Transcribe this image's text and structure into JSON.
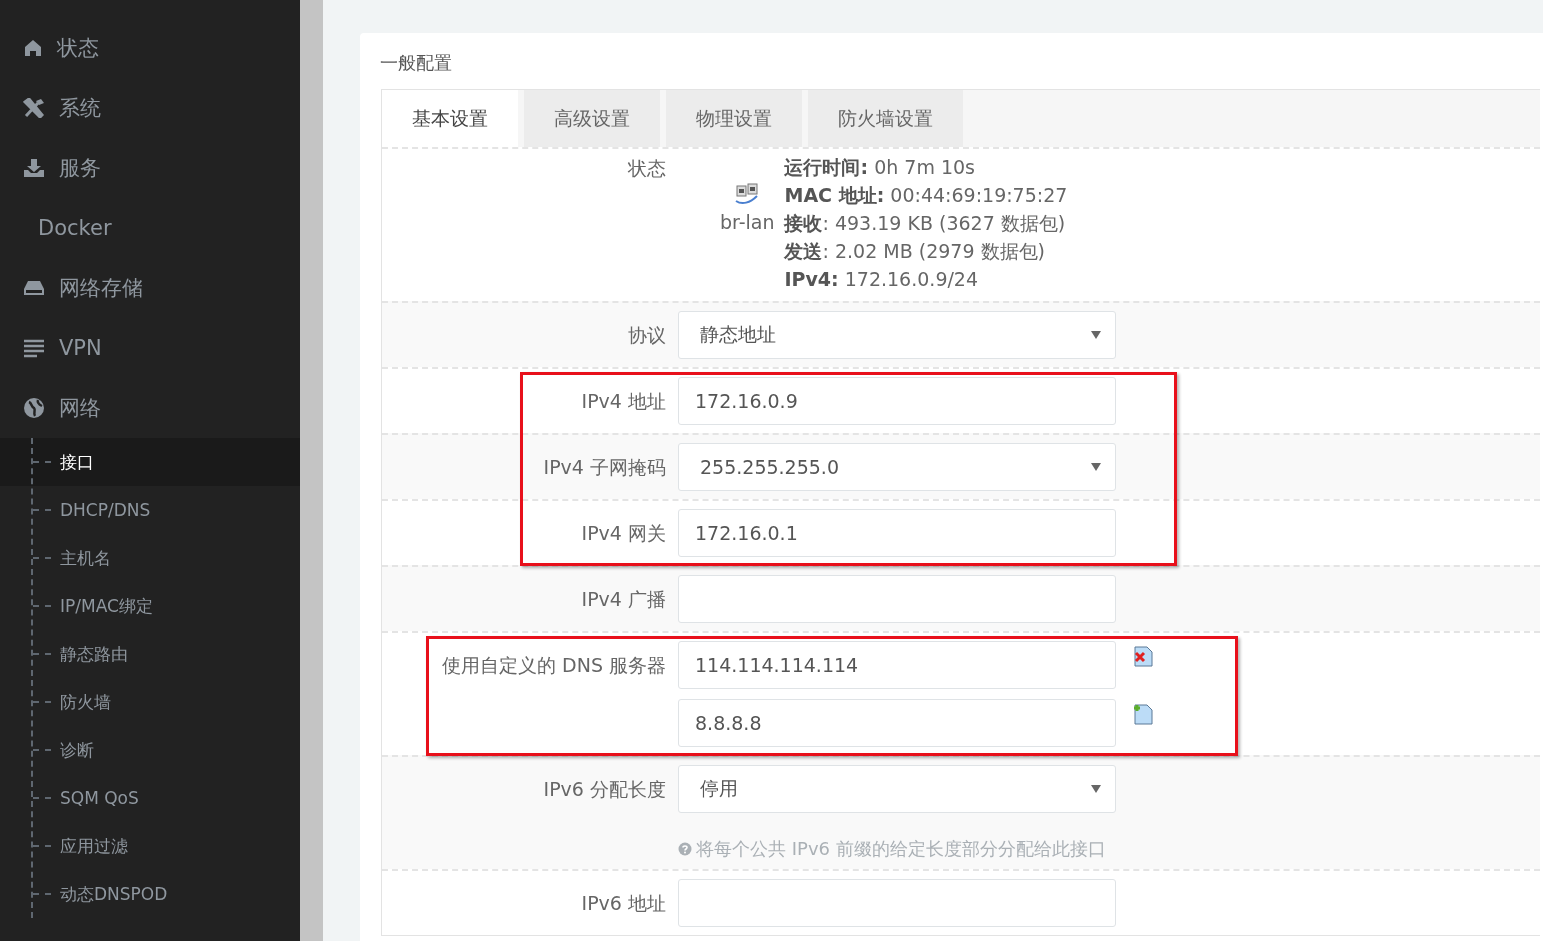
{
  "sidebar": {
    "items": [
      {
        "label": "状态",
        "selected": false
      },
      {
        "label": "系统",
        "selected": false
      },
      {
        "label": "服务",
        "selected": false
      },
      {
        "label": "Docker",
        "selected": false
      },
      {
        "label": "网络存储",
        "selected": false
      },
      {
        "label": "VPN",
        "selected": false
      },
      {
        "label": "网络",
        "selected": false,
        "expanded": true,
        "children": [
          {
            "label": "接口",
            "selected": true
          },
          {
            "label": "DHCP/DNS",
            "selected": false
          },
          {
            "label": "主机名",
            "selected": false
          },
          {
            "label": "IP/MAC绑定",
            "selected": false
          },
          {
            "label": "静态路由",
            "selected": false
          },
          {
            "label": "防火墙",
            "selected": false
          },
          {
            "label": "诊断",
            "selected": false
          },
          {
            "label": "SQM QoS",
            "selected": false
          },
          {
            "label": "应用过滤",
            "selected": false
          },
          {
            "label": "动态DNSPOD",
            "selected": false
          }
        ]
      }
    ]
  },
  "section_title": "一般配置",
  "tabs": [
    {
      "label": "基本设置",
      "selected": true
    },
    {
      "label": "高级设置",
      "selected": false
    },
    {
      "label": "物理设置",
      "selected": false
    },
    {
      "label": "防火墙设置",
      "selected": false
    }
  ],
  "rows": [
    {
      "kind": "status",
      "label": "状态",
      "device": "br-lan",
      "highlighted": false,
      "lines": [
        "**运行时间:** 0h 7m 10s",
        "**MAC 地址:** 00:44:69:19:75:27",
        "**接收**: 493.19 KB (3627 数据包)",
        "**发送**: 2.02 MB (2979 数据包)",
        "**IPv4:** 172.16.0.9/24"
      ]
    },
    {
      "kind": "select",
      "label": "协议",
      "value": "静态地址",
      "highlighted": false
    },
    {
      "kind": "input",
      "label": "IPv4 地址",
      "value": "172.16.0.9",
      "highlighted": true
    },
    {
      "kind": "select",
      "label": "IPv4 子网掩码",
      "value": "255.255.255.0",
      "highlighted": true
    },
    {
      "kind": "input",
      "label": "IPv4 网关",
      "value": "172.16.0.1",
      "highlighted": true
    },
    {
      "kind": "input",
      "label": "IPv4 广播",
      "highlighted": false
    },
    {
      "kind": "dynlist",
      "label": "使用自定义的 DNS 服务器",
      "values": [
        "114.114.114.114",
        "8.8.8.8"
      ],
      "highlighted": true
    },
    {
      "kind": "select",
      "label": "IPv6 分配长度",
      "value": "停用",
      "hint": "将每个公共 IPv6 前缀的给定长度部分分配给此接口",
      "highlighted": false
    },
    {
      "kind": "input",
      "label": "IPv6 地址",
      "highlighted": false
    }
  ]
}
